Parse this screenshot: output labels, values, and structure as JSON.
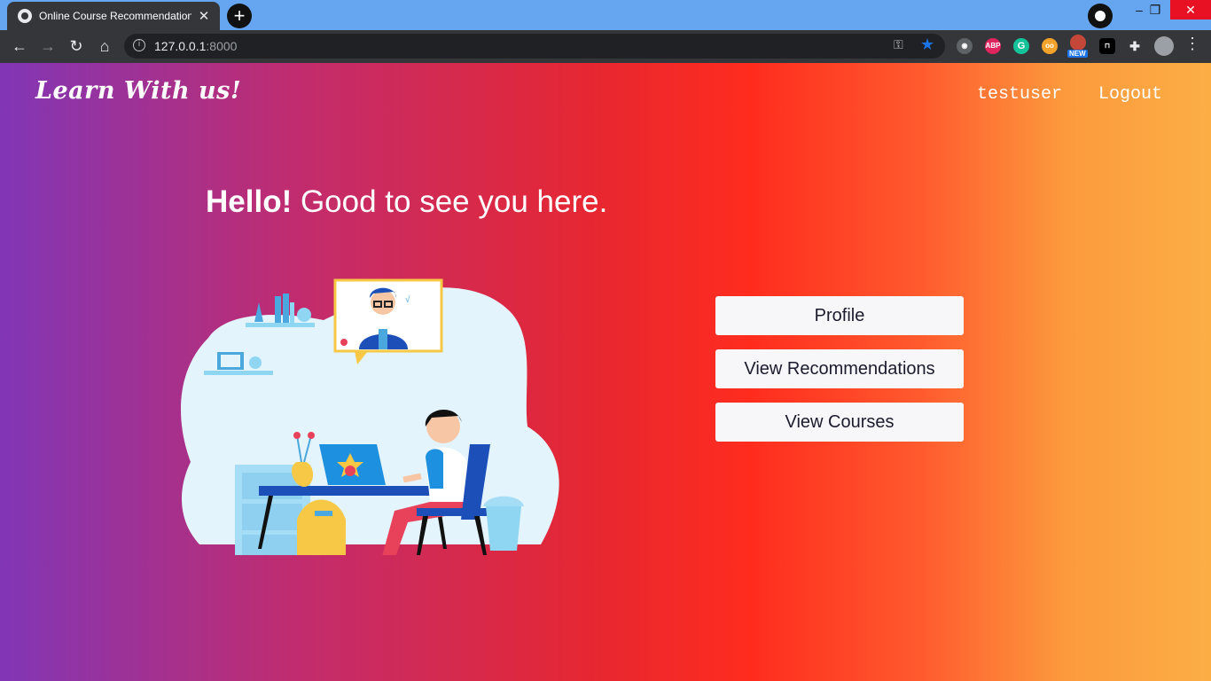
{
  "browser": {
    "tab_title": "Online Course Recommendation",
    "tab_close": "✕",
    "new_tab": "+",
    "url_host": "127.0.0.1",
    "url_port": ":8000",
    "win_min": "–",
    "win_max": "❐",
    "win_close": "✕"
  },
  "extensions": [
    "bulb-icon",
    "abp-icon",
    "grammarly-icon",
    "eyes-icon",
    "new-badge-icon",
    "lock-icon",
    "puzzle-icon",
    "avatar-icon"
  ],
  "ext_labels": {
    "abp": "ABP",
    "grammarly": "G",
    "new": "NEW"
  },
  "nav": {
    "brand": "Learn With us!",
    "username": "testuser",
    "logout": "Logout"
  },
  "hero": {
    "greeting_bold": "Hello!",
    "greeting_rest": " Good to see you here."
  },
  "actions": {
    "profile": "Profile",
    "recommendations": "View Recommendations",
    "courses": "View Courses"
  }
}
